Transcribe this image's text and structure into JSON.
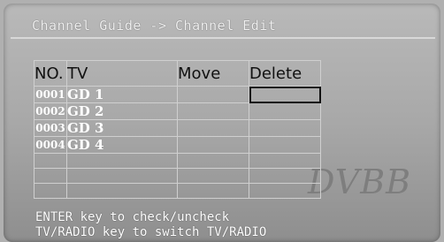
{
  "header": {
    "title": "Channel Guide -> Channel Edit"
  },
  "table": {
    "columns": [
      "NO.",
      "TV",
      "Move",
      "Delete"
    ],
    "rows": [
      {
        "no": "0001",
        "name": "GD 1",
        "move": "",
        "delete": ""
      },
      {
        "no": "0002",
        "name": "GD 2",
        "move": "",
        "delete": ""
      },
      {
        "no": "0003",
        "name": "GD 3",
        "move": "",
        "delete": ""
      },
      {
        "no": "0004",
        "name": "GD 4",
        "move": "",
        "delete": ""
      },
      {
        "no": "",
        "name": "",
        "move": "",
        "delete": ""
      },
      {
        "no": "",
        "name": "",
        "move": "",
        "delete": ""
      },
      {
        "no": "",
        "name": "",
        "move": "",
        "delete": ""
      }
    ],
    "selected": {
      "row": 0,
      "column": "delete"
    }
  },
  "watermark": "DVBB",
  "help": {
    "line1": "ENTER key to check/uncheck",
    "line2": "TV/RADIO key to switch TV/RADIO"
  }
}
